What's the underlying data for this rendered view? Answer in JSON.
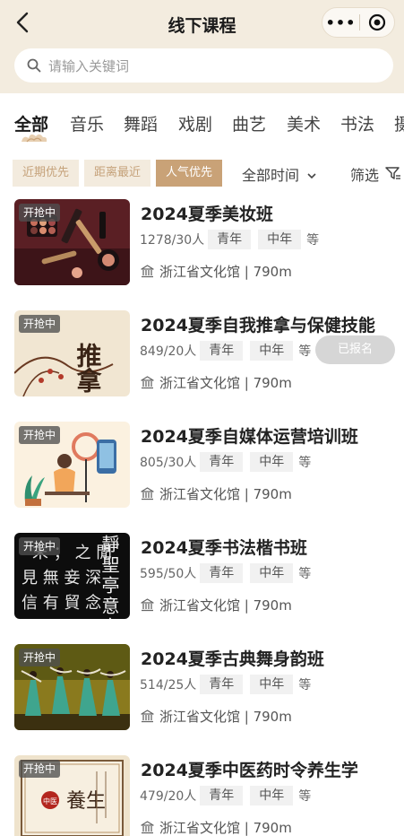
{
  "header": {
    "title": "线下课程",
    "more_label": "•••"
  },
  "search": {
    "placeholder": "请输入关键词"
  },
  "categories": [
    "全部",
    "音乐",
    "舞蹈",
    "戏剧",
    "曲艺",
    "美术",
    "书法",
    "摄"
  ],
  "filters": {
    "chips": [
      "近期优先",
      "距离最近",
      "人气优先"
    ],
    "active_chip": "人气优先",
    "time_label": "全部时间",
    "screen_label": "筛选"
  },
  "courses": [
    {
      "status": "开抢中",
      "title": "2024夏季美妆班",
      "count": "1278/30人",
      "tags": [
        "青年",
        "中年"
      ],
      "more": "等",
      "venue": "浙江省文化馆 | 790m"
    },
    {
      "status": "开抢中",
      "title": "2024夏季自我推拿与保健技能",
      "count": "849/20人",
      "tags": [
        "青年",
        "中年"
      ],
      "more": "等",
      "venue": "浙江省文化馆 | 790m",
      "enrolled": "已报名"
    },
    {
      "status": "开抢中",
      "title": "2024夏季自媒体运营培训班",
      "count": "805/30人",
      "tags": [
        "青年",
        "中年"
      ],
      "more": "等",
      "venue": "浙江省文化馆 | 790m"
    },
    {
      "status": "开抢中",
      "title": "2024夏季书法楷书班",
      "count": "595/50人",
      "tags": [
        "青年",
        "中年"
      ],
      "more": "等",
      "venue": "浙江省文化馆 | 790m"
    },
    {
      "status": "开抢中",
      "title": "2024夏季古典舞身韵班",
      "count": "514/25人",
      "tags": [
        "青年",
        "中年"
      ],
      "more": "等",
      "venue": "浙江省文化馆 | 790m"
    },
    {
      "status": "开抢中",
      "title": "2024夏季中医药时令养生学",
      "count": "479/20人",
      "tags": [
        "青年",
        "中年"
      ],
      "more": "等",
      "venue": "浙江省文化馆 | 790m"
    }
  ],
  "thumb_art": {
    "tuina": "推拿",
    "calligraphy": "靜聖亭意之聞來深不有念而無茶",
    "tcm_seal": "中医",
    "tcm_text": "養生"
  },
  "colors": {
    "accent": "#c9a277",
    "header_bg": "#f3ecdf",
    "chip_bg": "#f3ebde"
  }
}
